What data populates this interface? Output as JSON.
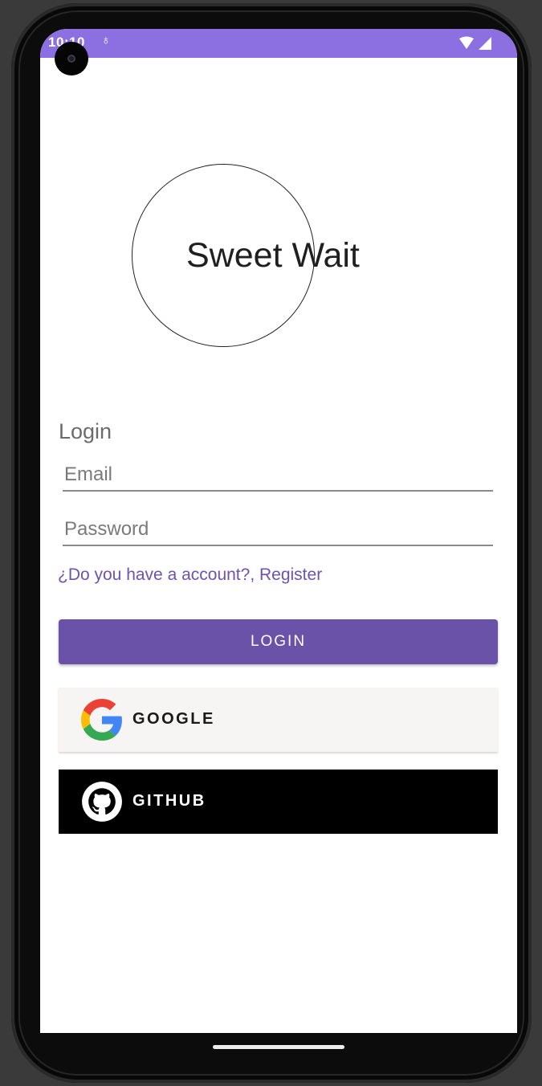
{
  "status_bar": {
    "time": "10:10",
    "notification_icon": "usb-icon",
    "right_icons": [
      "wifi-icon",
      "signal-icon"
    ],
    "color": "#8c6fe0"
  },
  "logo": {
    "text": "Sweet Wait"
  },
  "login": {
    "title": "Login",
    "email_placeholder": "Email",
    "email_value": "",
    "password_placeholder": "Password",
    "password_value": "",
    "register_link": "¿Do you have a account?, Register",
    "login_button": "LOGIN"
  },
  "social": {
    "google_label": "GOOGLE",
    "google_icon": "google-icon",
    "github_label": "GITHUB",
    "github_icon": "github-icon"
  },
  "colors": {
    "accent": "#6a52a8",
    "link": "#6c53b0",
    "status_bar": "#8c6fe0"
  }
}
